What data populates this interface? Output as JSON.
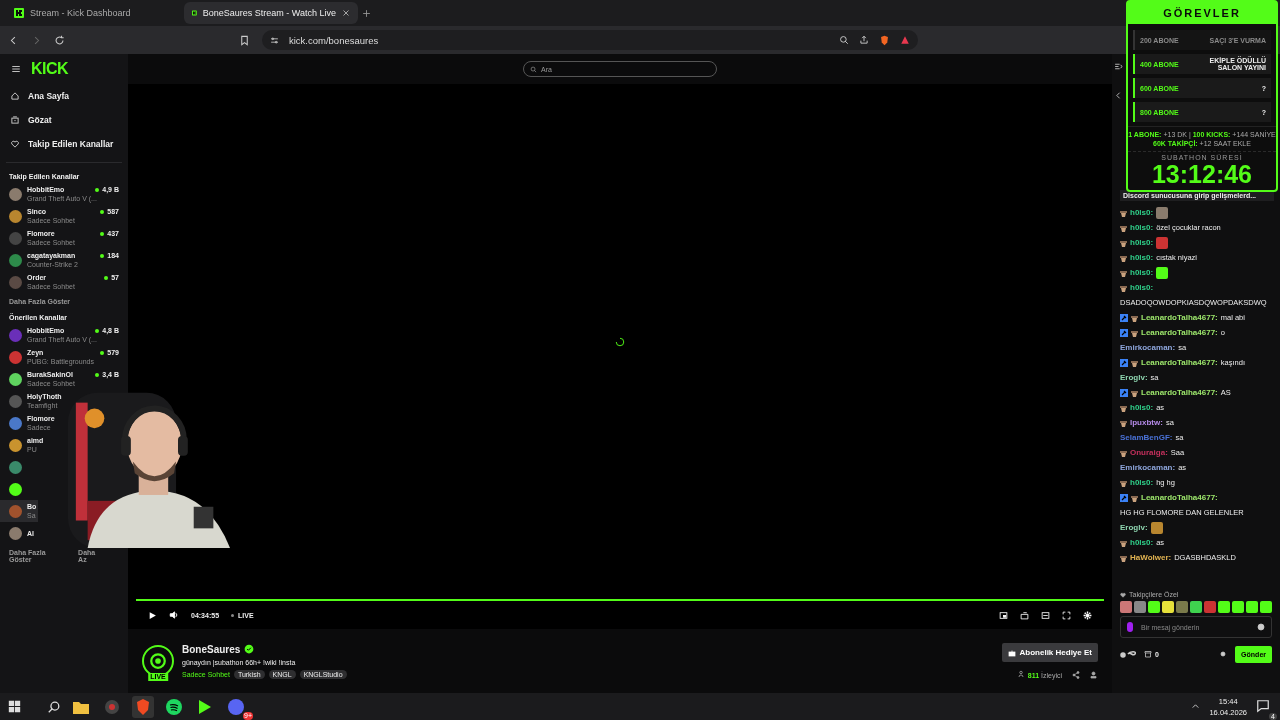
{
  "browser": {
    "tabs": [
      {
        "title": "Stream - Kick Dashboard",
        "selected": false
      },
      {
        "title": "BoneSaures Stream - Watch Live",
        "selected": true
      }
    ],
    "url": "kick.com/bonesaures"
  },
  "header": {
    "logo": "KICK",
    "search_placeholder": "Ara"
  },
  "nav": [
    {
      "label": "Ana Sayfa"
    },
    {
      "label": "Gözat"
    },
    {
      "label": "Takip Edilen Kanallar"
    }
  ],
  "followed": {
    "title": "Takip Edilen Kanallar",
    "more": "Daha Fazla Göster",
    "channels": [
      {
        "kind": "channel",
        "name": "HobbitEmo",
        "category": "Grand Theft Auto V (...",
        "viewers": "4,9 B"
      },
      {
        "kind": "channel",
        "name": "Sinco",
        "category": "Sadece Sohbet",
        "viewers": "587"
      },
      {
        "kind": "channel",
        "name": "Flomore",
        "category": "Sadece Sohbet",
        "viewers": "437"
      },
      {
        "kind": "channel",
        "name": "cagatayakman",
        "category": "Counter-Strike 2",
        "viewers": "184"
      },
      {
        "kind": "channel",
        "name": "Order",
        "category": "Sadece Sohbet",
        "viewers": "57"
      }
    ]
  },
  "recommended": {
    "title": "Önerilen Kanallar",
    "more": "Daha Fazla Göster",
    "less": "Daha Az",
    "channels": [
      {
        "kind": "channel",
        "name": "HobbitEmo",
        "category": "Grand Theft Auto V (...",
        "viewers": "4,8 B",
        "selected": false
      },
      {
        "kind": "channel",
        "name": "Zeyn",
        "category": "PUBG: Battlegrounds",
        "viewers": "579",
        "selected": false
      },
      {
        "kind": "channel",
        "name": "BurakSakinOl",
        "category": "Sadece Sohbet",
        "viewers": "3,4 B",
        "selected": false
      },
      {
        "kind": "channel",
        "name": "HolyThoth",
        "category": "Teamfight",
        "selected": false
      },
      {
        "kind": "channel",
        "name": "Flomore",
        "category": "Sadece",
        "selected": false
      },
      {
        "kind": "channel",
        "name": "aimd",
        "category": "PU",
        "selected": false
      },
      {
        "kind": "avatar",
        "selected": false
      },
      {
        "kind": "avatar",
        "selected": false
      },
      {
        "kind": "channel",
        "name": "Bo",
        "category": "Sa",
        "selected": true
      },
      {
        "kind": "channel",
        "name": "Al",
        "selected": false
      }
    ]
  },
  "player": {
    "progress": {
      "level": 1
    },
    "time": "04:34:55",
    "live": "LIVE"
  },
  "stream": {
    "name": "BoneSaures",
    "verified": true,
    "avatar_badge": "LIVE",
    "title": "günaydın |subathon 66h+ !wiki !insta",
    "category": "Sadece Sohbet",
    "tags": [
      "Turkish",
      "KNGL",
      "KNGLStudio"
    ],
    "gift_button": "Abonelik Hediye Et",
    "viewers": "811",
    "viewers_label": "İzleyici"
  },
  "goals": {
    "title": "GÖREVLER",
    "items": [
      {
        "target": "200 ABONE",
        "reward": "SAÇI 3'E VURMA",
        "done": true
      },
      {
        "target": "400 ABONE",
        "reward": "EKİPLE ÖDÜLLÜ SALON YAYINI",
        "done": false
      },
      {
        "target": "600 ABONE",
        "reward": "?",
        "done": false
      },
      {
        "target": "800 ABONE",
        "reward": "?",
        "done": false
      }
    ],
    "info": [
      "**1 ABONE:** +13 DK | **100 KICKS:** +144 SANİYE",
      "**60K TAKİPÇİ:** +12 SAAT EKLE"
    ],
    "timer_label": "SUBATHON SÜRESİ",
    "timer": "13:12:46"
  },
  "chat": {
    "separator": ":",
    "pinned": "Discord sunucusuna girip gelişmelerd...",
    "messages": [
      {
        "user": "h0ls0",
        "color": "#2fd18a",
        "moderator": false,
        "subscriber": true,
        "kind": "emote"
      },
      {
        "user": "h0ls0",
        "color": "#2fd18a",
        "moderator": false,
        "subscriber": true,
        "kind": "text",
        "text": "özel çocuklar racon"
      },
      {
        "user": "h0ls0",
        "color": "#2fd18a",
        "moderator": false,
        "subscriber": true,
        "kind": "emote"
      },
      {
        "user": "h0ls0",
        "color": "#2fd18a",
        "moderator": false,
        "subscriber": true,
        "kind": "text",
        "text": "cıstak niyazi"
      },
      {
        "user": "h0ls0",
        "color": "#2fd18a",
        "moderator": false,
        "subscriber": true,
        "kind": "emote"
      },
      {
        "user": "h0ls0",
        "color": "#2fd18a",
        "moderator": false,
        "subscriber": true,
        "kind": "text",
        "text": "DSADOQOWDOPKIASDQWOPDAKSDWQ"
      },
      {
        "user": "LeanardoTalha4677",
        "color": "#9ee86c",
        "moderator": true,
        "subscriber": true,
        "kind": "text",
        "text": "mal abi"
      },
      {
        "user": "LeanardoTalha4677",
        "color": "#9ee86c",
        "moderator": true,
        "subscriber": true,
        "kind": "text",
        "text": "o"
      },
      {
        "user": "Emirkocaman",
        "color": "#8ea6dc",
        "moderator": false,
        "subscriber": false,
        "kind": "text",
        "text": "sa"
      },
      {
        "user": "LeanardoTalha4677",
        "color": "#9ee86c",
        "moderator": true,
        "subscriber": true,
        "kind": "text",
        "text": "kaşındı"
      },
      {
        "user": "Eroglv",
        "color": "#8fd6b0",
        "moderator": false,
        "subscriber": false,
        "kind": "text",
        "text": "sa"
      },
      {
        "user": "LeanardoTalha4677",
        "color": "#9ee86c",
        "moderator": true,
        "subscriber": true,
        "kind": "text",
        "text": "AS"
      },
      {
        "user": "h0ls0",
        "color": "#2fd18a",
        "moderator": false,
        "subscriber": true,
        "kind": "text",
        "text": "as"
      },
      {
        "user": "Ipuxbtw",
        "color": "#b48ae8",
        "moderator": false,
        "subscriber": true,
        "kind": "text",
        "text": "sa"
      },
      {
        "user": "SelamBenGF",
        "color": "#4a72d8",
        "moderator": false,
        "subscriber": false,
        "kind": "text",
        "text": "sa"
      },
      {
        "user": "Onuraiga",
        "color": "#c4305c",
        "moderator": false,
        "subscriber": true,
        "kind": "text",
        "text": "Saa"
      },
      {
        "user": "Emirkocaman",
        "color": "#8ea6dc",
        "moderator": false,
        "subscriber": false,
        "kind": "text",
        "text": "as"
      },
      {
        "user": "h0ls0",
        "color": "#2fd18a",
        "moderator": false,
        "subscriber": true,
        "kind": "text",
        "text": "hg hg"
      },
      {
        "user": "LeanardoTalha4677",
        "color": "#9ee86c",
        "moderator": true,
        "subscriber": true,
        "kind": "text",
        "text": "HG HG FLOMORE DAN GELENLER"
      },
      {
        "user": "Eroglv",
        "color": "#8fd6b0",
        "moderator": false,
        "subscriber": false,
        "kind": "emote"
      },
      {
        "user": "h0ls0",
        "color": "#2fd18a",
        "moderator": false,
        "subscriber": true,
        "kind": "text",
        "text": "as"
      },
      {
        "user": "HaWolwer",
        "color": "#e2b452",
        "moderator": false,
        "subscriber": true,
        "kind": "text",
        "text": "DGASBHDASKLD"
      }
    ],
    "emote_label": "Takipçilere Özel",
    "placeholder": "Bir mesaj gönderin",
    "points": "0",
    "send": "Gönder"
  },
  "taskbar": {
    "discord_badge": "9+",
    "time": "15:44",
    "date": "16.04.2026",
    "notifications": "4"
  }
}
